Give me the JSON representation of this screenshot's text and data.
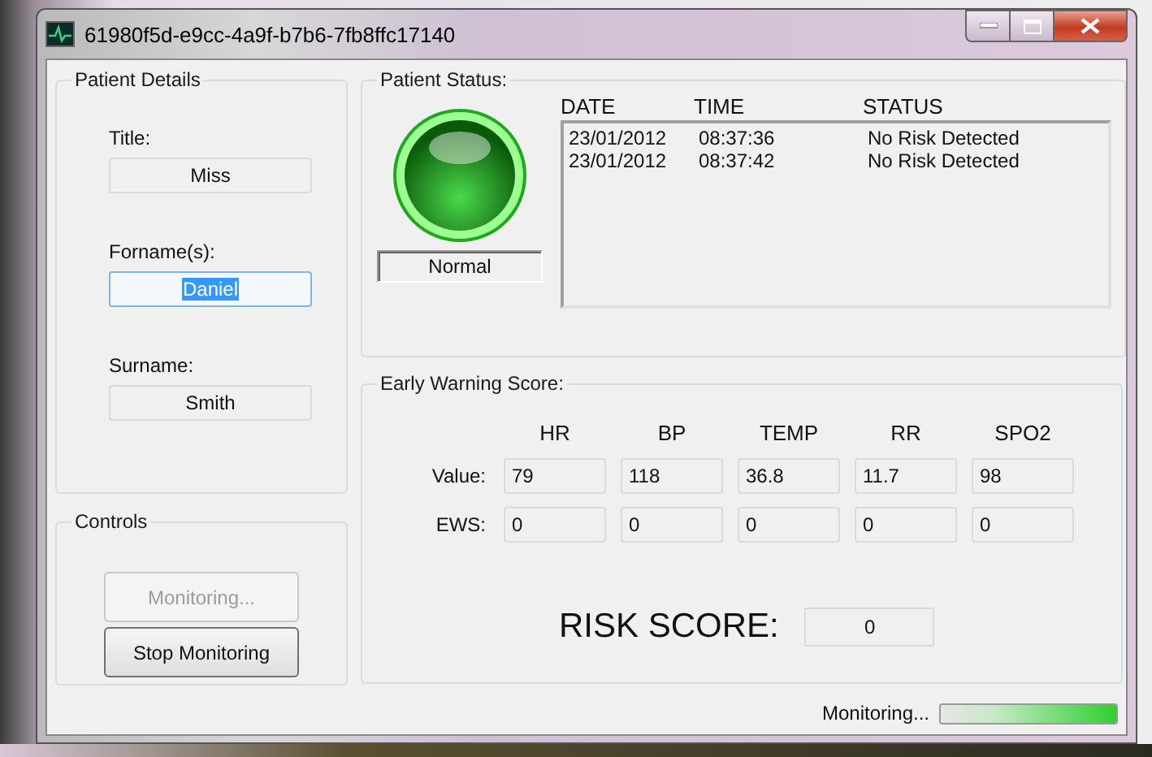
{
  "window": {
    "title": "61980f5d-e9cc-4a9f-b7b6-7fb8ffc17140"
  },
  "patient_details": {
    "title": "Patient Details",
    "fields": [
      {
        "label": "Title:",
        "value": "Miss",
        "focused": false
      },
      {
        "label": "Forname(s):",
        "value": "Daniel",
        "focused": true
      },
      {
        "label": "Surname:",
        "value": "Smith",
        "focused": false
      }
    ]
  },
  "controls": {
    "title": "Controls",
    "buttons": [
      {
        "label": "Monitoring...",
        "disabled": true
      },
      {
        "label": "Stop Monitoring",
        "disabled": false
      }
    ]
  },
  "patient_status": {
    "title": "Patient Status:",
    "indicator": {
      "kind": "normal",
      "label": "Normal"
    },
    "log": {
      "columns": [
        "DATE",
        "TIME",
        "STATUS"
      ],
      "rows": [
        [
          "23/01/2012",
          "08:37:36",
          "No Risk Detected"
        ],
        [
          "23/01/2012",
          "08:37:42",
          "No Risk Detected"
        ]
      ]
    }
  },
  "early_warning_score": {
    "title": "Early Warning Score:",
    "columns": [
      "HR",
      "BP",
      "TEMP",
      "RR",
      "SPO2"
    ],
    "rows": [
      {
        "label": "Value:",
        "cells": [
          "79",
          "118",
          "36.8",
          "11.7",
          "98"
        ]
      },
      {
        "label": "EWS:",
        "cells": [
          "0",
          "0",
          "0",
          "0",
          "0"
        ]
      }
    ],
    "risk_score": {
      "label": "RISK SCORE:",
      "value": "0"
    }
  },
  "status_bar": {
    "text": "Monitoring...",
    "progress": {
      "level": 1
    }
  }
}
